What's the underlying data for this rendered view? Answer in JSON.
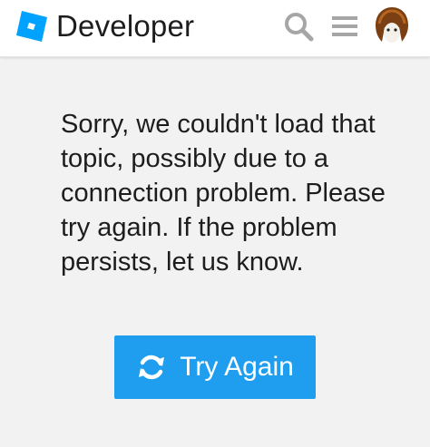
{
  "header": {
    "brand": "Developer",
    "search_icon": "search-icon",
    "menu_icon": "hamburger-menu-icon",
    "logo_icon": "roblox-logo-icon"
  },
  "error": {
    "message": "Sorry, we couldn't load that topic, possibly due to a connection problem. Please try again. If the problem persists, let us know.",
    "button_label": "Try Again",
    "button_icon": "refresh-icon"
  },
  "colors": {
    "accent": "#1f9ef0",
    "logo": "#00a2ff",
    "background": "#f2f2f2",
    "header_background": "#ffffff",
    "icon_gray": "#a6a6a6"
  }
}
